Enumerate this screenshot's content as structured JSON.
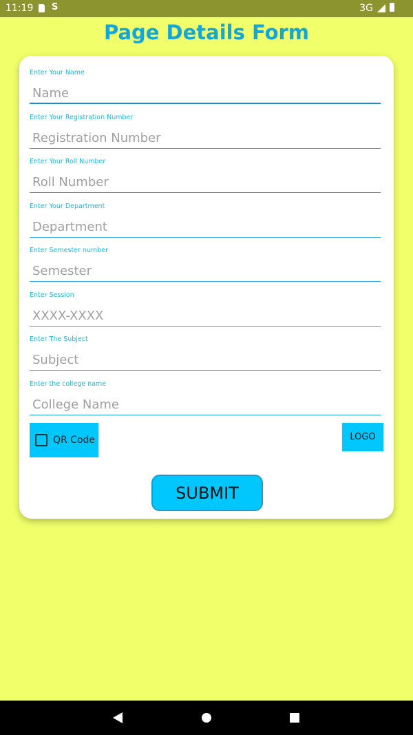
{
  "status_bar": {
    "time": "11:19",
    "network": "3G",
    "icons": [
      "sd-card-icon",
      "sync-icon",
      "signal-icon",
      "battery-icon"
    ]
  },
  "page_title": "Page Details Form",
  "form": {
    "fields": [
      {
        "label": "Enter Your Name",
        "placeholder": "Name",
        "value": ""
      },
      {
        "label": "Enter Your Registration Number",
        "placeholder": "Registration Number",
        "value": ""
      },
      {
        "label": "Enter Your Roll Number",
        "placeholder": "Roll Number",
        "value": ""
      },
      {
        "label": "Enter Your Department",
        "placeholder": "Department",
        "value": ""
      },
      {
        "label": "Enter Semester number",
        "placeholder": "Semester",
        "value": ""
      },
      {
        "label": "Enter Session",
        "placeholder": "XXXX-XXXX",
        "value": ""
      },
      {
        "label": "Enter The Subject",
        "placeholder": "Subject",
        "value": ""
      },
      {
        "label": "Enter the college name",
        "placeholder": "College Name",
        "value": ""
      }
    ],
    "qr_checkbox_label": "QR Code",
    "qr_checked": false,
    "logo_button_label": "LOGO",
    "submit_button_label": "SUBMIT"
  },
  "colors": {
    "background": "#F0FF6A",
    "status_bar": "#8C9430",
    "title": "#13A6D8",
    "label": "#1EB8D8",
    "accent": "#00C8FF"
  },
  "nav_bar": {
    "icons": [
      "back-icon",
      "home-icon",
      "recents-icon"
    ]
  }
}
